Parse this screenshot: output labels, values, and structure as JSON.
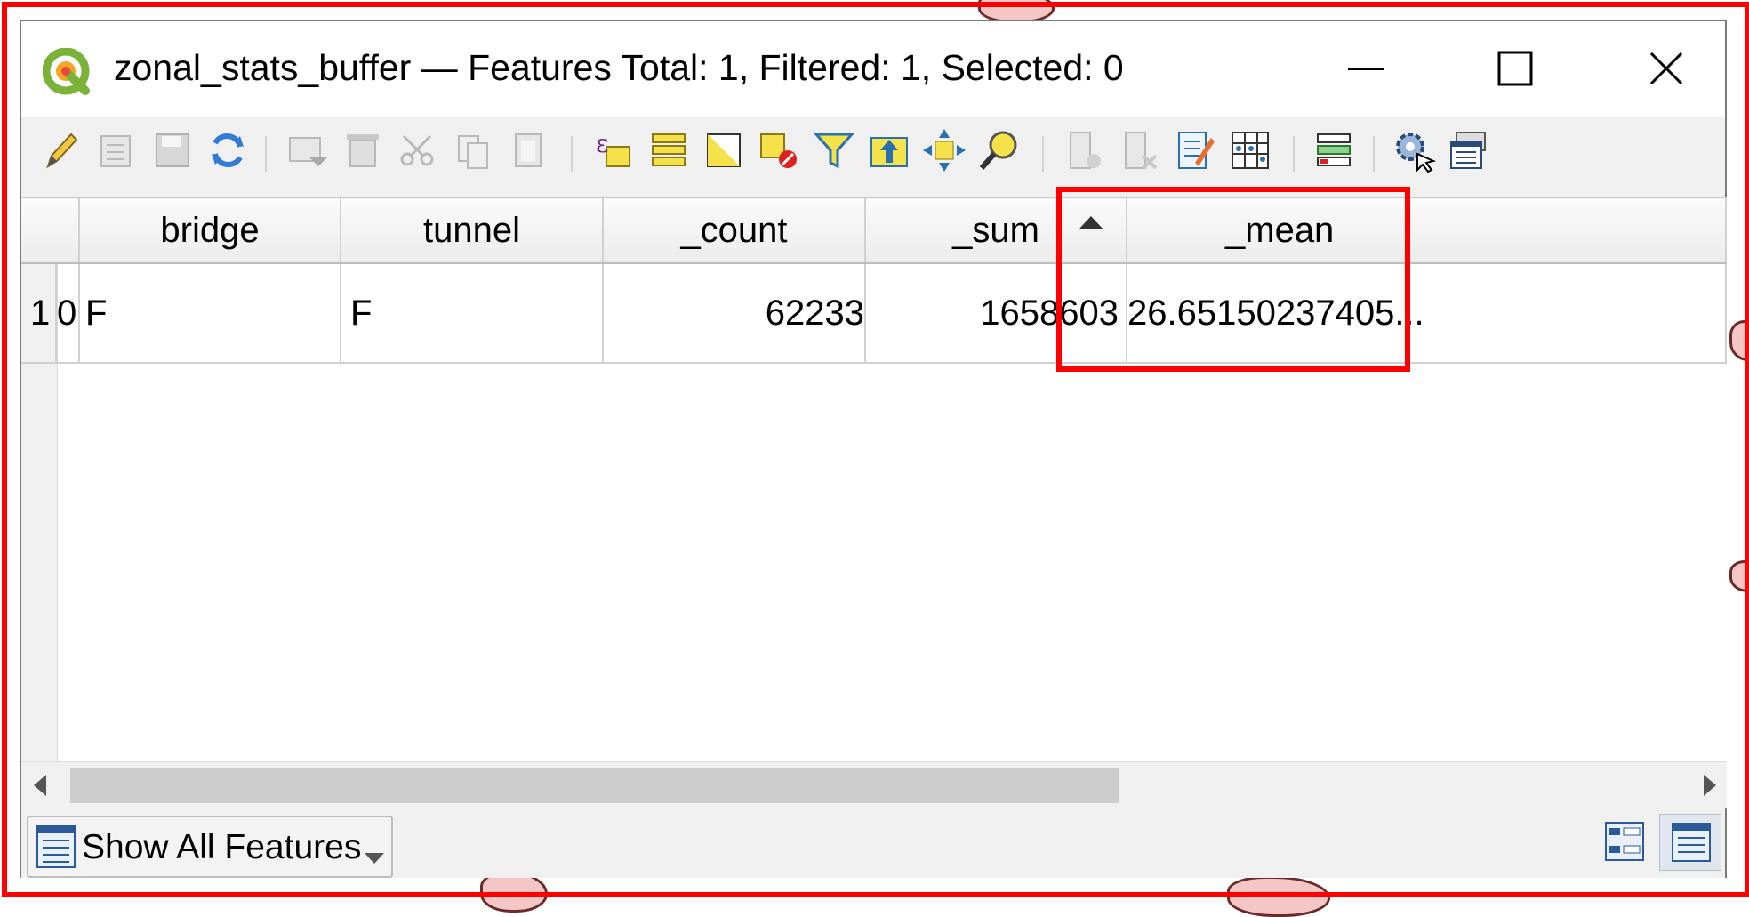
{
  "window": {
    "title": "zonal_stats_buffer — Features Total: 1, Filtered: 1, Selected: 0"
  },
  "toolbar": {
    "buttons": [
      "toggle-editing-icon",
      "multi-edit-icon",
      "save-edits-icon",
      "reload-icon",
      "add-feature-icon",
      "delete-feature-icon",
      "cut-icon",
      "copy-icon",
      "paste-icon",
      "select-by-expression-icon",
      "select-all-icon",
      "invert-selection-icon",
      "deselect-all-icon",
      "filter-select-icon",
      "move-selection-to-top-icon",
      "pan-to-selection-icon",
      "zoom-to-selection-icon",
      "new-field-icon",
      "delete-field-icon",
      "open-field-calculator-icon",
      "conditional-formatting-icon",
      "organize-columns-icon",
      "actions-icon",
      "dock-table-icon"
    ]
  },
  "table": {
    "columns": [
      "bridge",
      "tunnel",
      "_count",
      "_sum",
      "_mean"
    ],
    "sorted_column": "_sum",
    "rows": [
      {
        "row_header": "1",
        "id": "0",
        "bridge": "F",
        "tunnel": "F",
        "_count": "62233",
        "_sum": "1658603",
        "_mean": "26.65150237405..."
      }
    ]
  },
  "bottom": {
    "show_button_label": "Show All Features"
  },
  "colors": {
    "highlight": "#ff0000",
    "window_bg": "#f0f0f0"
  }
}
